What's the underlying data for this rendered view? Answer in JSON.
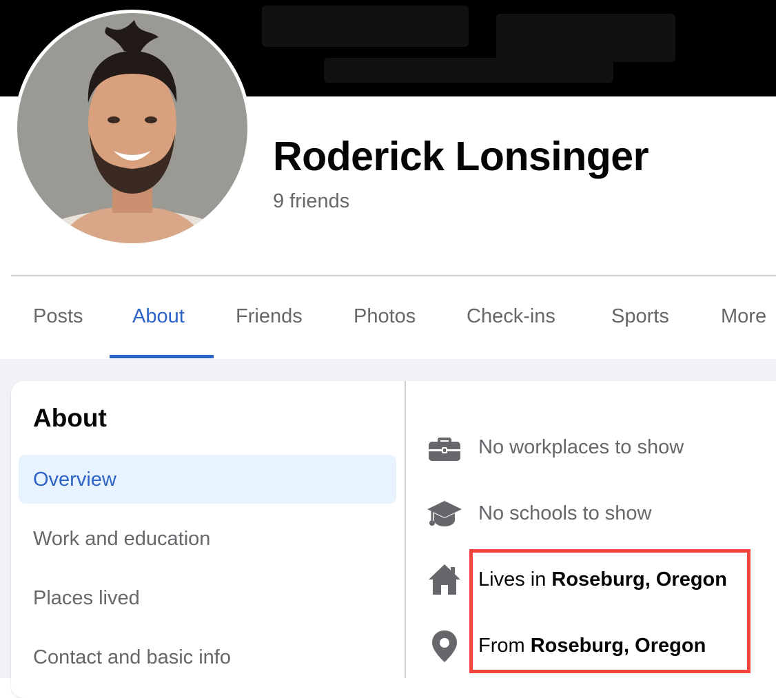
{
  "profile": {
    "name": "Roderick Lonsinger",
    "friends": "9 friends"
  },
  "tabs": [
    {
      "label": "Posts",
      "active": false
    },
    {
      "label": "About",
      "active": true
    },
    {
      "label": "Friends",
      "active": false
    },
    {
      "label": "Photos",
      "active": false
    },
    {
      "label": "Check-ins",
      "active": false
    },
    {
      "label": "Sports",
      "active": false
    },
    {
      "label": "More",
      "active": false
    }
  ],
  "about": {
    "title": "About",
    "menu": [
      {
        "label": "Overview",
        "active": true
      },
      {
        "label": "Work and education",
        "active": false
      },
      {
        "label": "Places lived",
        "active": false
      },
      {
        "label": "Contact and basic info",
        "active": false
      }
    ],
    "overview": {
      "work": {
        "icon": "briefcase-icon",
        "text": "No workplaces to show"
      },
      "school": {
        "icon": "graduation-cap-icon",
        "text": "No schools to show"
      },
      "lives": {
        "icon": "home-icon",
        "prefix": "Lives in ",
        "place": "Roseburg, Oregon"
      },
      "from": {
        "icon": "location-pin-icon",
        "prefix": "From ",
        "place": "Roseburg, Oregon"
      }
    }
  },
  "colors": {
    "accent": "#2d62c6",
    "secondary_text": "#65676b",
    "highlight_border": "#f1453d",
    "selected_bg": "#e7f3ff"
  }
}
